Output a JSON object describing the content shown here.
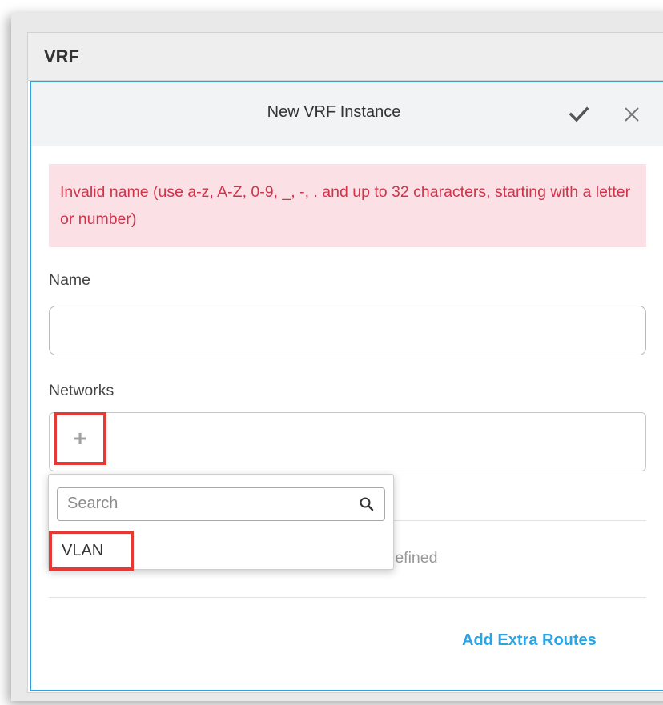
{
  "panel": {
    "title": "VRF"
  },
  "form": {
    "title": "New VRF Instance",
    "confirm_icon": "checkmark-icon",
    "close_icon": "close-icon",
    "error_message": "Invalid name (use a-z, A-Z, 0-9, _, -, . and up to 32 characters, starting with a letter or number)",
    "name_label": "Name",
    "name_value": "",
    "networks_label": "Networks",
    "add_network_icon": "+",
    "empty_text_fragment": "lefined",
    "add_extra_routes_label": "Add Extra Routes"
  },
  "dropdown": {
    "search_placeholder": "Search",
    "search_icon": "search-icon",
    "items": [
      {
        "label": "VLAN"
      }
    ]
  },
  "colors": {
    "accent": "#2ea2e0",
    "error_bg": "#fbe1e5",
    "error_text": "#d0334a",
    "highlight": "#e53935",
    "link": "#29a4e4"
  }
}
